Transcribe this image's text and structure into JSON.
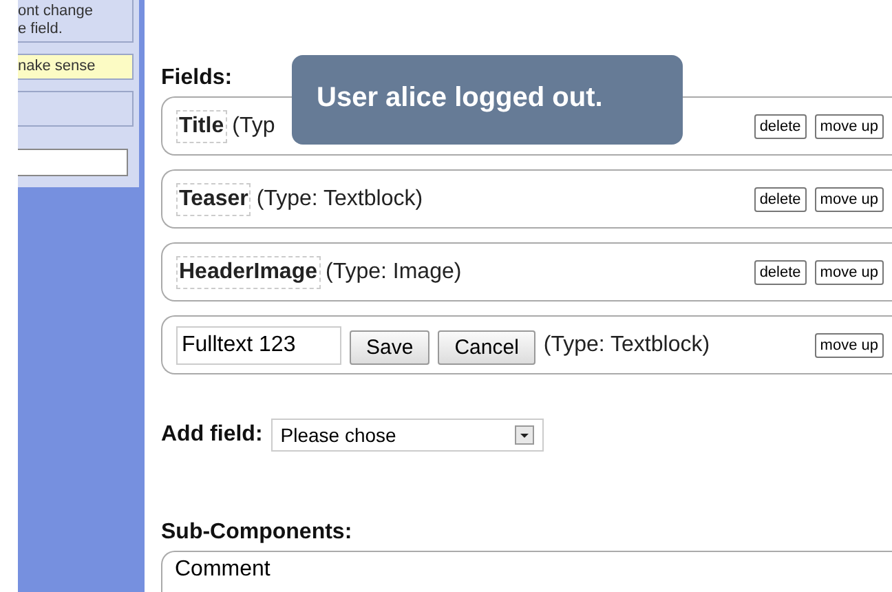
{
  "sidebar": {
    "notes": [
      {
        "kind": "plain",
        "lines": [
          "ont change",
          "e field."
        ]
      },
      {
        "kind": "highlight",
        "lines": [
          "nake sense"
        ]
      },
      {
        "kind": "empty"
      }
    ]
  },
  "fields_heading": "Fields:",
  "fields": [
    {
      "kind": "display",
      "name": "Title",
      "type": "(Typ",
      "buttons": [
        "delete",
        "move up"
      ]
    },
    {
      "kind": "display",
      "name": "Teaser",
      "type": "(Type: Textblock)",
      "buttons": [
        "delete",
        "move up"
      ]
    },
    {
      "kind": "display",
      "name": "HeaderImage",
      "type": "(Type: Image)",
      "buttons": [
        "delete",
        "move up"
      ]
    },
    {
      "kind": "editing",
      "value": "Fulltext 123",
      "actions": [
        "Save",
        "Cancel"
      ],
      "type": "(Type: Textblock)",
      "buttons": [
        "move up"
      ]
    }
  ],
  "add_field": {
    "label": "Add field:",
    "value": "Please chose"
  },
  "subcomponents": {
    "heading": "Sub-Components:",
    "items": [
      "Comment"
    ]
  },
  "toast": "User alice logged out."
}
